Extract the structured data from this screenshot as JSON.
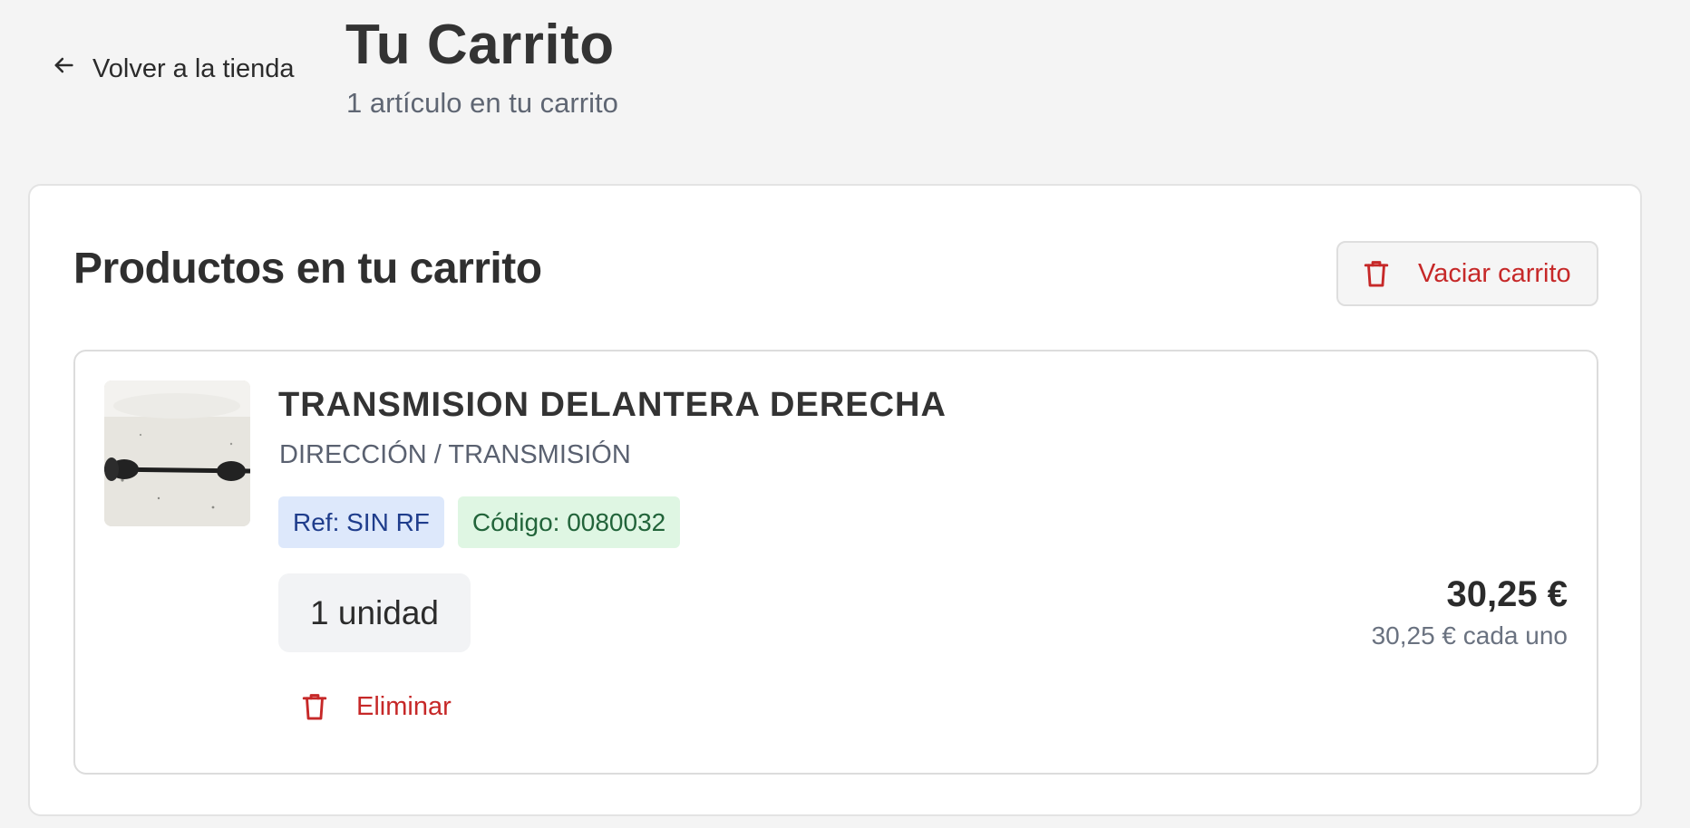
{
  "header": {
    "back_label": "Volver a la tienda",
    "title": "Tu Carrito",
    "subtitle": "1 artículo en tu carrito"
  },
  "cart": {
    "section_title": "Productos en tu carrito",
    "empty_label": "Vaciar carrito"
  },
  "item": {
    "name": "TRANSMISION DELANTERA DERECHA",
    "category": "DIRECCIÓN / TRANSMISIÓN",
    "ref": "Ref: SIN RF",
    "code": "Código: 0080032",
    "quantity": "1 unidad",
    "price": "30,25 €",
    "unit_price": "30,25 € cada uno",
    "remove_label": "Eliminar"
  },
  "colors": {
    "accent_red": "#c62828",
    "ref_tag_bg": "#dde8fb",
    "code_tag_bg": "#dff6e3"
  }
}
